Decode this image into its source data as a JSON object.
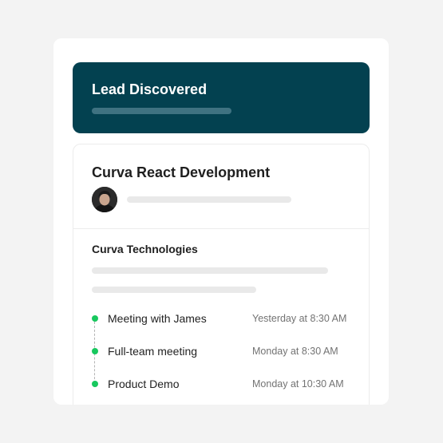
{
  "header": {
    "title": "Lead Discovered"
  },
  "lead": {
    "title": "Curva React Development",
    "company": "Curva Technologies"
  },
  "activities": [
    {
      "label": "Meeting with James",
      "time": "Yesterday at 8:30 AM"
    },
    {
      "label": "Full-team meeting",
      "time": "Monday at 8:30 AM"
    },
    {
      "label": "Product Demo",
      "time": "Monday at 10:30 AM"
    }
  ],
  "colors": {
    "header_bg": "#034150",
    "status_dot": "#18c85e",
    "background": "#f3f3f3"
  }
}
